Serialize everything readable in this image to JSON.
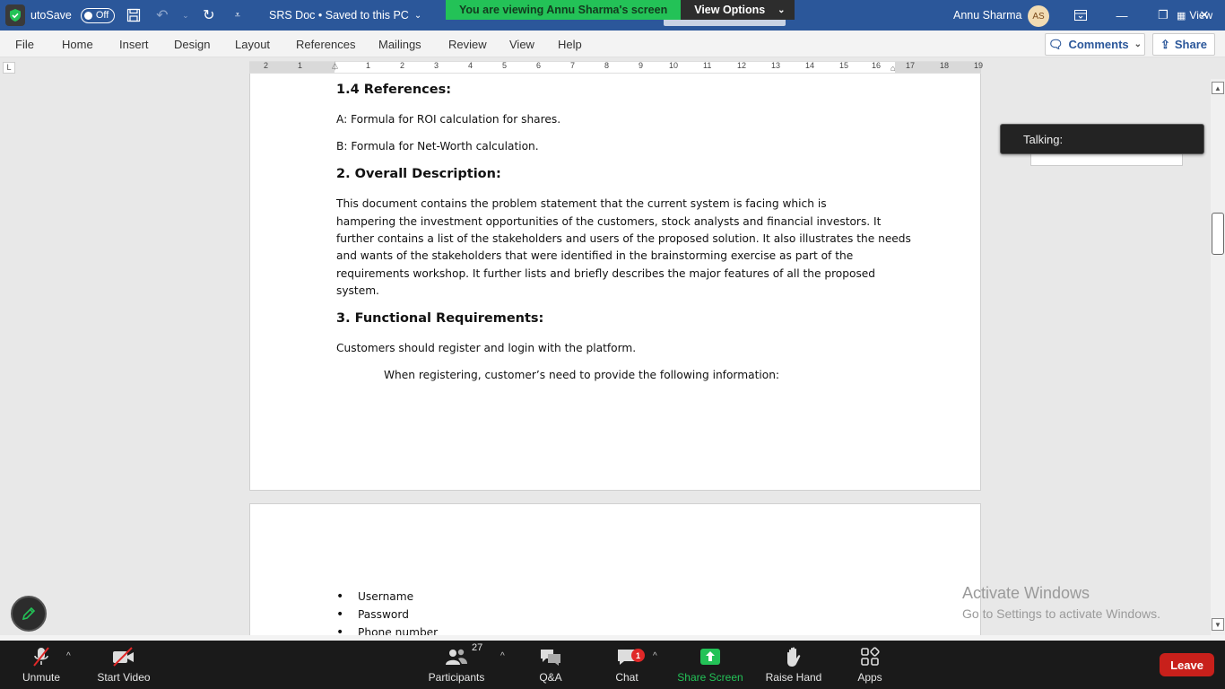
{
  "titlebar": {
    "autosave_label": "utoSave",
    "autosave_state": "Off",
    "doc_title": "SRS Doc • Saved to this PC",
    "user_name": "Annu Sharma",
    "user_initials": "AS",
    "view_label": "View"
  },
  "zoom_banner": {
    "message": "You are viewing Annu Sharma's screen",
    "options_label": "View Options"
  },
  "menu": {
    "items": [
      "File",
      "Home",
      "Insert",
      "Design",
      "Layout",
      "References",
      "Mailings",
      "Review",
      "View",
      "Help"
    ],
    "comments_label": "Comments",
    "share_label": "Share"
  },
  "ruler": {
    "labels": [
      "2",
      "1",
      "1",
      "2",
      "3",
      "4",
      "5",
      "6",
      "7",
      "8",
      "9",
      "10",
      "11",
      "12",
      "13",
      "14",
      "15",
      "16",
      "17",
      "18",
      "19"
    ]
  },
  "document": {
    "heading_references": "1.4 References:",
    "ref_a": "A: Formula for ROI calculation for shares.",
    "ref_b": "B: Formula for Net-Worth calculation.",
    "heading_overall": "2. Overall Description:",
    "overall_lines": [
      "This document contains the problem statement that the current system is facing which is",
      "hampering the investment opportunities of the customers, stock analysts and financial investors. It",
      "further contains a list of the stakeholders and users of the proposed solution. It also illustrates the needs",
      "and wants of the stakeholders that were identified in the brainstorming exercise as part of the",
      "requirements workshop. It further lists and briefly describes the major features of all the proposed",
      "system."
    ],
    "heading_functional": "3. Functional Requirements:",
    "func_line1": "Customers should register and login with the platform.",
    "func_line2": "When registering, customer’s need to provide the following information:",
    "bullets": [
      "Username",
      "Password",
      "Phone number"
    ]
  },
  "watermark": {
    "title": "Activate Windows",
    "subtitle": "Go to Settings to activate Windows."
  },
  "talking_popup": {
    "label": "Talking:"
  },
  "zoom_toolbar": {
    "unmute": "Unmute",
    "start_video": "Start Video",
    "participants": "Participants",
    "participants_count": "27",
    "qa": "Q&A",
    "chat": "Chat",
    "chat_badge": "1",
    "share_screen": "Share Screen",
    "raise_hand": "Raise Hand",
    "apps": "Apps",
    "leave": "Leave"
  },
  "colors": {
    "word_blue": "#2b579a",
    "zoom_green": "#23c257",
    "leave_red": "#c8201b",
    "toolbar_bg": "#1a1a1a"
  }
}
